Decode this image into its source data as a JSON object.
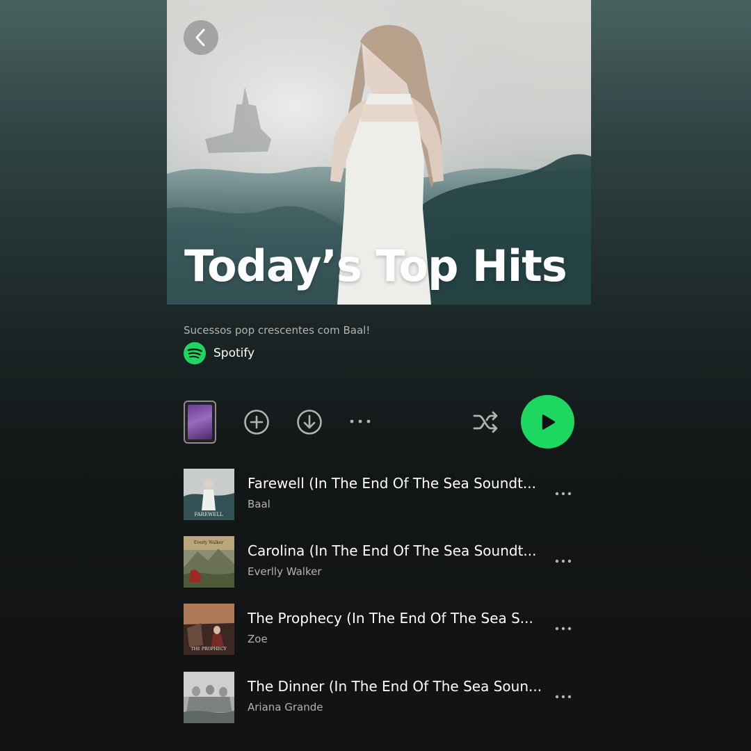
{
  "playlist": {
    "title": "Today’s Top Hits",
    "description": "Sucessos pop crescentes com Baal!",
    "owner": "Spotify"
  },
  "icons": {
    "back": "chevron-left-icon",
    "add": "plus-circle-icon",
    "download": "download-circle-icon",
    "more": "more-horizontal-icon",
    "shuffle": "shuffle-icon",
    "play": "play-icon",
    "owner_logo": "spotify-logo-icon"
  },
  "colors": {
    "accent": "#1ed760",
    "text_primary": "#ffffff",
    "text_secondary": "#b3b3b3",
    "background": "#121212"
  },
  "tracks": [
    {
      "title": "Farewell (In The End Of The Sea Soundt...",
      "artist": "Baal",
      "art_caption": "FAREWELL"
    },
    {
      "title": "Carolina (In The End Of The Sea Soundt...",
      "artist": "Everlly Walker",
      "art_caption": "Everly Walker"
    },
    {
      "title": "The Prophecy (In The End Of The Sea S...",
      "artist": "Zoe",
      "art_caption": "THE PROPHECY"
    },
    {
      "title": "The Dinner (In The End Of The Sea Soun...",
      "artist": "Ariana Grande",
      "art_caption": ""
    }
  ]
}
